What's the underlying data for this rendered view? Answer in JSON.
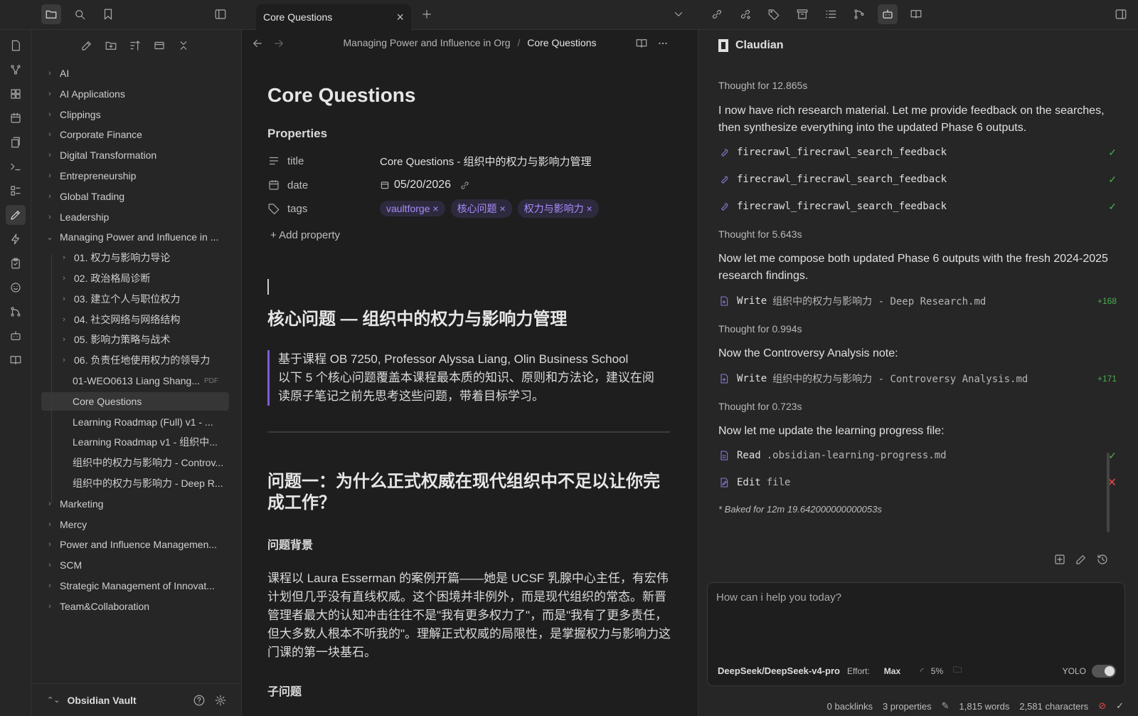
{
  "tab": {
    "title": "Core Questions"
  },
  "sidebar": {
    "folders": [
      {
        "label": "AI",
        "expanded": false
      },
      {
        "label": "AI Applications",
        "expanded": false
      },
      {
        "label": "Clippings",
        "expanded": false
      },
      {
        "label": "Corporate Finance",
        "expanded": false
      },
      {
        "label": "Digital Transformation",
        "expanded": false
      },
      {
        "label": "Entrepreneurship",
        "expanded": false
      },
      {
        "label": "Global Trading",
        "expanded": false
      },
      {
        "label": "Leadership",
        "expanded": false
      },
      {
        "label": "Managing Power and Influence in ...",
        "expanded": true
      }
    ],
    "children": [
      {
        "label": "01. 权力与影响力导论",
        "folder": true
      },
      {
        "label": "02. 政治格局诊断",
        "folder": true
      },
      {
        "label": "03. 建立个人与职位权力",
        "folder": true
      },
      {
        "label": "04. 社交网络与网络结构",
        "folder": true
      },
      {
        "label": "05. 影响力策略与战术",
        "folder": true
      },
      {
        "label": "06. 负责任地使用权力的领导力",
        "folder": true
      },
      {
        "label": "01-WEO0613 Liang Shang...",
        "folder": false,
        "badge": "PDF"
      },
      {
        "label": "Core Questions",
        "folder": false,
        "selected": true
      },
      {
        "label": "Learning Roadmap (Full) v1 - ...",
        "folder": false
      },
      {
        "label": "Learning Roadmap v1 - 组织中...",
        "folder": false
      },
      {
        "label": "组织中的权力与影响力 - Controv...",
        "folder": false
      },
      {
        "label": "组织中的权力与影响力 - Deep R...",
        "folder": false
      }
    ],
    "folders_after": [
      {
        "label": "Marketing"
      },
      {
        "label": "Mercy"
      },
      {
        "label": "Power and Influence Managemen..."
      },
      {
        "label": "SCM"
      },
      {
        "label": "Strategic Management of Innovat..."
      },
      {
        "label": "Team&Collaboration"
      }
    ],
    "vault": "Obsidian Vault"
  },
  "editor": {
    "breadcrumb_parent": "Managing Power and Influence in Org",
    "breadcrumb_sep": "/",
    "breadcrumb_current": "Core Questions",
    "title": "Core Questions",
    "properties_heading": "Properties",
    "props": {
      "title_key": "title",
      "title_val": "Core Questions - 组织中的权力与影响力管理",
      "date_key": "date",
      "date_val": "05/20/2026",
      "tags_key": "tags",
      "tags": [
        "vaultforge",
        "核心问题",
        "权力与影响力"
      ]
    },
    "add_property": "Add property",
    "h2_main": "核心问题 — 组织中的权力与影响力管理",
    "quote_line1": "基于课程 OB 7250, Professor Alyssa Liang, Olin Business School",
    "quote_line2": "以下 5 个核心问题覆盖本课程最本质的知识、原则和方法论，建议在阅读原子笔记之前先思考这些问题，带着目标学习。",
    "h2_q1": "问题一：为什么正式权威在现代组织中不足以让你完成工作？",
    "h3_bg": "问题背景",
    "para_bg": "课程以 Laura Esserman 的案例开篇——她是 UCSF 乳腺中心主任，有宏伟计划但几乎没有直线权威。这个困境并非例外，而是现代组织的常态。新晋管理者最大的认知冲击往往不是\"我有更多权力了\"，而是\"我有了更多责任，但大多数人根本不听我的\"。理解正式权威的局限性，是掌握权力与影响力这门课的第一块基石。",
    "h3_sub": "子问题"
  },
  "panel": {
    "title": "Claudian",
    "t1": "Thought for 12.865s",
    "m1": "I now have rich research material. Let me provide feedback on the searches, then synthesize everything into the updated Phase 6 outputs.",
    "tool_search": "firecrawl_firecrawl_search_feedback",
    "t2": "Thought for 5.643s",
    "m2": "Now let me compose both updated Phase 6 outputs with the fresh 2024-2025 research findings.",
    "w1_name": "Write",
    "w1_arg": "组织中的权力与影响力 - Deep Research.md",
    "w1_diff": "+168",
    "t3": "Thought for 0.994s",
    "m3": "Now the Controversy Analysis note:",
    "w2_name": "Write",
    "w2_arg": "组织中的权力与影响力 - Controversy Analysis.md",
    "w2_diff": "+171",
    "t4": "Thought for 0.723s",
    "m4": "Now let me update the learning progress file:",
    "r_name": "Read",
    "r_arg": ".obsidian-learning-progress.md",
    "e_name": "Edit",
    "e_arg": "file",
    "baked": "* Baked for 12m 19.642000000000053s",
    "input_placeholder": "How can i help you today?",
    "model": "DeepSeek/DeepSeek-v4-pro",
    "effort_label": "Effort:",
    "effort": "Max",
    "context": "5%",
    "yolo": "YOLO"
  },
  "status": {
    "backlinks": "0 backlinks",
    "properties": "3 properties",
    "words": "1,815 words",
    "chars": "2,581 characters"
  },
  "colors": {
    "accent": "#7c5cd6",
    "tag_text": "#a88bfa",
    "ok": "#4caf50",
    "error": "#e5484d"
  }
}
